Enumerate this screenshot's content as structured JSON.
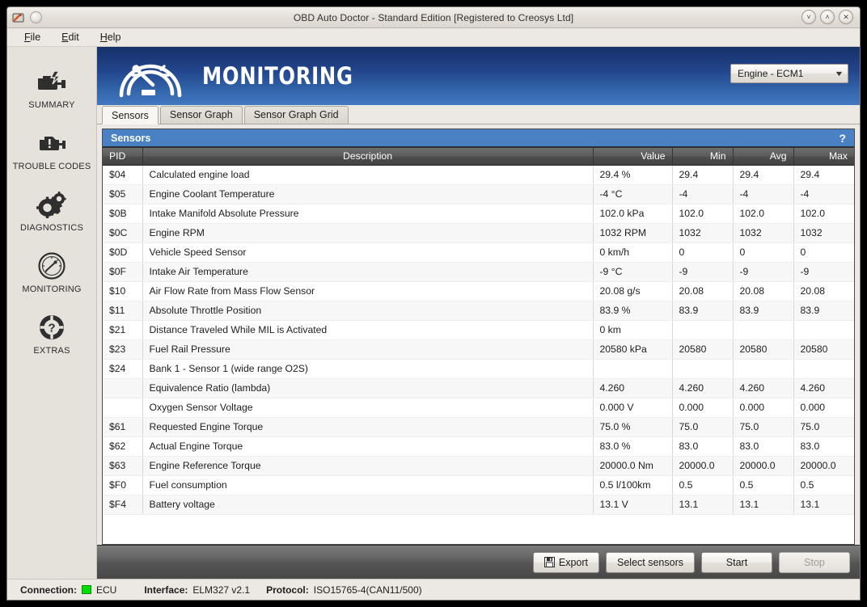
{
  "window": {
    "title": "OBD Auto Doctor - Standard Edition [Registered to Creosys Ltd]",
    "app_icon": "obd-app-icon",
    "minimize_glyph": "˅",
    "maximize_glyph": "˄",
    "close_glyph": "✕"
  },
  "menubar": {
    "items": [
      {
        "label": "File",
        "mnemonic": "F",
        "rest": "ile"
      },
      {
        "label": "Edit",
        "mnemonic": "E",
        "rest": "dit"
      },
      {
        "label": "Help",
        "mnemonic": "H",
        "rest": "elp"
      }
    ]
  },
  "sidebar": {
    "items": [
      {
        "label": "SUMMARY",
        "icon": "engine-wrench-icon"
      },
      {
        "label": "TROUBLE CODES",
        "icon": "engine-warning-icon"
      },
      {
        "label": "DIAGNOSTICS",
        "icon": "gears-icon"
      },
      {
        "label": "MONITORING",
        "icon": "gauge-icon"
      },
      {
        "label": "EXTRAS",
        "icon": "question-lifering-icon"
      }
    ],
    "active": "MONITORING"
  },
  "banner": {
    "title": "MONITORING",
    "logo_icon": "gauge-logo-icon",
    "gradient_from": "#17316a",
    "gradient_to": "#4278c0",
    "ecu_select": {
      "value": "Engine - ECM1",
      "caret": "▼"
    }
  },
  "tabs": [
    {
      "label": "Sensors",
      "active": true
    },
    {
      "label": "Sensor Graph",
      "active": false
    },
    {
      "label": "Sensor Graph Grid",
      "active": false
    }
  ],
  "panel": {
    "title": "Sensors",
    "help_glyph": "?",
    "accent": "#4a81c4"
  },
  "table": {
    "columns": [
      "PID",
      "Description",
      "Value",
      "Min",
      "Avg",
      "Max"
    ],
    "rows": [
      {
        "pid": "$04",
        "desc": "Calculated engine load",
        "value": "29.4 %",
        "min": "29.4",
        "avg": "29.4",
        "max": "29.4",
        "sub": false
      },
      {
        "pid": "$05",
        "desc": "Engine Coolant Temperature",
        "value": "-4 °C",
        "min": "-4",
        "avg": "-4",
        "max": "-4",
        "sub": false
      },
      {
        "pid": "$0B",
        "desc": "Intake Manifold Absolute Pressure",
        "value": "102.0 kPa",
        "min": "102.0",
        "avg": "102.0",
        "max": "102.0",
        "sub": false
      },
      {
        "pid": "$0C",
        "desc": "Engine RPM",
        "value": "1032 RPM",
        "min": "1032",
        "avg": "1032",
        "max": "1032",
        "sub": false
      },
      {
        "pid": "$0D",
        "desc": "Vehicle Speed Sensor",
        "value": "0 km/h",
        "min": "0",
        "avg": "0",
        "max": "0",
        "sub": false
      },
      {
        "pid": "$0F",
        "desc": "Intake Air Temperature",
        "value": "-9 °C",
        "min": "-9",
        "avg": "-9",
        "max": "-9",
        "sub": false
      },
      {
        "pid": "$10",
        "desc": "Air Flow Rate from Mass Flow Sensor",
        "value": "20.08 g/s",
        "min": "20.08",
        "avg": "20.08",
        "max": "20.08",
        "sub": false
      },
      {
        "pid": "$11",
        "desc": "Absolute Throttle Position",
        "value": "83.9 %",
        "min": "83.9",
        "avg": "83.9",
        "max": "83.9",
        "sub": false
      },
      {
        "pid": "$21",
        "desc": "Distance Traveled While MIL is Activated",
        "value": "0 km",
        "min": "",
        "avg": "",
        "max": "",
        "sub": false
      },
      {
        "pid": "$23",
        "desc": "Fuel Rail Pressure",
        "value": "20580 kPa",
        "min": "20580",
        "avg": "20580",
        "max": "20580",
        "sub": false
      },
      {
        "pid": "$24",
        "desc": "Bank 1 - Sensor 1 (wide range O2S)",
        "value": "",
        "min": "",
        "avg": "",
        "max": "",
        "sub": false
      },
      {
        "pid": "",
        "desc": "Equivalence Ratio (lambda)",
        "value": "4.260",
        "min": "4.260",
        "avg": "4.260",
        "max": "4.260",
        "sub": true
      },
      {
        "pid": "",
        "desc": "Oxygen Sensor Voltage",
        "value": "0.000 V",
        "min": "0.000",
        "avg": "0.000",
        "max": "0.000",
        "sub": true
      },
      {
        "pid": "$61",
        "desc": "Requested Engine Torque",
        "value": "75.0 %",
        "min": "75.0",
        "avg": "75.0",
        "max": "75.0",
        "sub": false
      },
      {
        "pid": "$62",
        "desc": "Actual Engine Torque",
        "value": "83.0 %",
        "min": "83.0",
        "avg": "83.0",
        "max": "83.0",
        "sub": false
      },
      {
        "pid": "$63",
        "desc": "Engine Reference Torque",
        "value": "20000.0 Nm",
        "min": "20000.0",
        "avg": "20000.0",
        "max": "20000.0",
        "sub": false
      },
      {
        "pid": "$F0",
        "desc": "Fuel consumption",
        "value": "0.5 l/100km",
        "min": "0.5",
        "avg": "0.5",
        "max": "0.5",
        "sub": false
      },
      {
        "pid": "$F4",
        "desc": "Battery voltage",
        "value": "13.1 V",
        "min": "13.1",
        "avg": "13.1",
        "max": "13.1",
        "sub": false
      }
    ]
  },
  "footer": {
    "buttons": [
      {
        "label": "Export",
        "icon": "floppy-disk-icon",
        "enabled": true
      },
      {
        "label": "Select sensors",
        "icon": null,
        "enabled": true
      },
      {
        "label": "Start",
        "icon": null,
        "enabled": true
      },
      {
        "label": "Stop",
        "icon": null,
        "enabled": false
      }
    ]
  },
  "statusbar": {
    "connection_label": "Connection:",
    "connection_value": "ECU",
    "connection_led_color": "#00e000",
    "interface_label": "Interface:",
    "interface_value": "ELM327 v2.1",
    "protocol_label": "Protocol:",
    "protocol_value": "ISO15765-4(CAN11/500)"
  }
}
